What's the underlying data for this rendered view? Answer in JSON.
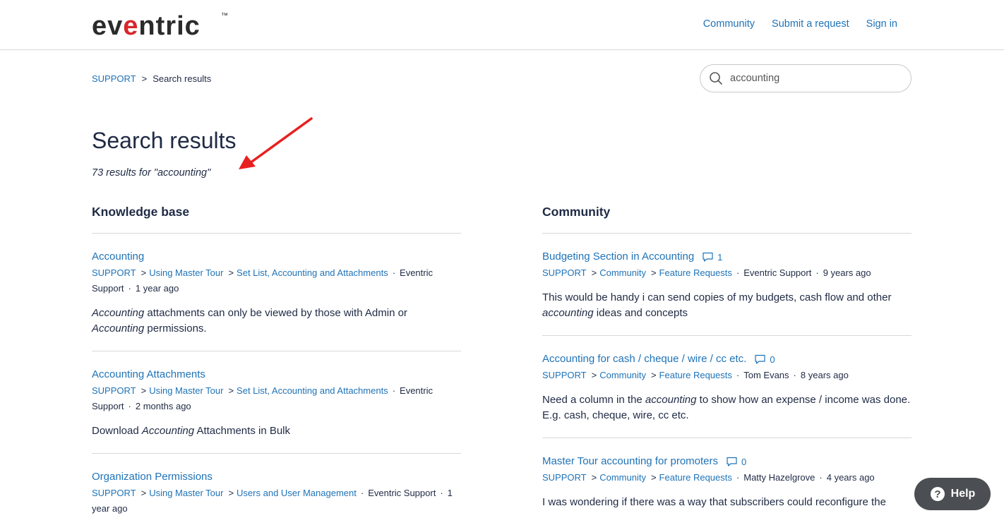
{
  "header": {
    "logo_text": "eventric",
    "trademark": "™",
    "nav": [
      "Community",
      "Submit a request",
      "Sign in"
    ]
  },
  "breadcrumb": {
    "root": "SUPPORT",
    "separator": ">",
    "current": "Search results"
  },
  "search": {
    "value": "accounting",
    "icon": "search-icon"
  },
  "page": {
    "title": "Search results",
    "result_count": "73 results for \"accounting\""
  },
  "knowledge_base": {
    "heading": "Knowledge base",
    "results": [
      {
        "title": "Accounting",
        "path": [
          "SUPPORT",
          "Using Master Tour",
          "Set List, Accounting and Attachments"
        ],
        "author": "Eventric Support",
        "time": "1 year ago",
        "snippet": [
          [
            "em",
            "Accounting"
          ],
          [
            "t",
            " attachments can only be viewed by those with Admin or "
          ],
          [
            "em",
            "Accounting"
          ],
          [
            "t",
            " permissions."
          ]
        ]
      },
      {
        "title": "Accounting Attachments",
        "path": [
          "SUPPORT",
          "Using Master Tour",
          "Set List, Accounting and Attachments"
        ],
        "author": "Eventric Support",
        "time": "2 months ago",
        "snippet": [
          [
            "t",
            "Download "
          ],
          [
            "em",
            "Accounting"
          ],
          [
            "t",
            " Attachments in Bulk"
          ]
        ]
      },
      {
        "title": "Organization Permissions",
        "path": [
          "SUPPORT",
          "Using Master Tour",
          "Users and User Management"
        ],
        "author": "Eventric Support",
        "time": "1 year ago",
        "snippet": []
      }
    ]
  },
  "community": {
    "heading": "Community",
    "results": [
      {
        "title": "Budgeting Section in Accounting",
        "comments": "1",
        "path": [
          "SUPPORT",
          "Community",
          "Feature Requests"
        ],
        "author": "Eventric Support",
        "time": "9 years ago",
        "snippet": [
          [
            "t",
            "This would be handy i can send copies of my budgets, cash flow and other "
          ],
          [
            "em",
            "accounting"
          ],
          [
            "t",
            " ideas and concepts"
          ]
        ]
      },
      {
        "title": "Accounting for cash / cheque / wire / cc etc.",
        "comments": "0",
        "path": [
          "SUPPORT",
          "Community",
          "Feature Requests"
        ],
        "author": "Tom Evans",
        "time": "8 years ago",
        "snippet": [
          [
            "t",
            "Need a column in the "
          ],
          [
            "em",
            "accounting"
          ],
          [
            "t",
            " to show how an expense / income was done. E.g. cash, cheque, wire, cc etc."
          ]
        ]
      },
      {
        "title": "Master Tour accounting for promoters",
        "comments": "0",
        "path": [
          "SUPPORT",
          "Community",
          "Feature Requests"
        ],
        "author": "Matty Hazelgrove",
        "time": "4 years ago",
        "snippet": [
          [
            "t",
            "I was wondering if there was a way that subscribers could reconfigure the"
          ]
        ]
      }
    ]
  },
  "help_button": {
    "label": "Help",
    "icon": "question-icon"
  },
  "colors": {
    "link": "#1f73b7",
    "text": "#1f2a44",
    "logo_red": "#d8262b",
    "logo_dark": "#2b2b2b",
    "arrow": "#e8201f",
    "help_bg": "#4b4e52"
  }
}
